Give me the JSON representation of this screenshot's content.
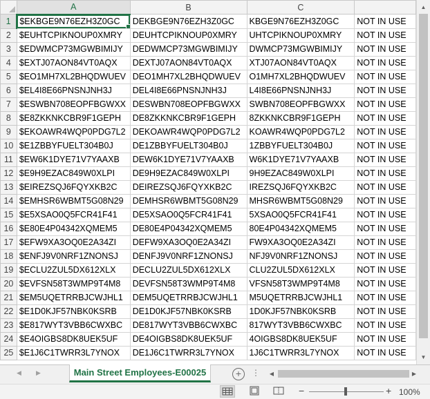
{
  "columns": [
    "A",
    "B",
    "C",
    ""
  ],
  "rows": [
    {
      "num": "1",
      "a": "$EKBGE9N76EZH3Z0GC",
      "b": "DEKBGE9N76EZH3Z0GC",
      "c": "KBGE9N76EZH3Z0GC",
      "d": "NOT IN USE"
    },
    {
      "num": "2",
      "a": "$EUHTCPIKNOUP0XMRY",
      "b": "DEUHTCPIKNOUP0XMRY",
      "c": "UHTCPIKNOUP0XMRY",
      "d": "NOT IN USE"
    },
    {
      "num": "3",
      "a": "$EDWMCP73MGWBIMIJY",
      "b": "DEDWMCP73MGWBIMIJY",
      "c": "DWMCP73MGWBIMIJY",
      "d": "NOT IN USE"
    },
    {
      "num": "4",
      "a": "$EXTJ07AON84VT0AQX",
      "b": "DEXTJ07AON84VT0AQX",
      "c": "XTJ07AON84VT0AQX",
      "d": "NOT IN USE"
    },
    {
      "num": "5",
      "a": "$EO1MH7XL2BHQDWUEV",
      "b": "DEO1MH7XL2BHQDWUEV",
      "c": "O1MH7XL2BHQDWUEV",
      "d": "NOT IN USE"
    },
    {
      "num": "6",
      "a": "$EL4I8E66PNSNJNH3J",
      "b": "DEL4I8E66PNSNJNH3J",
      "c": "L4I8E66PNSNJNH3J",
      "d": "NOT IN USE"
    },
    {
      "num": "7",
      "a": "$ESWBN708EOPFBGWXX",
      "b": "DESWBN708EOPFBGWXX",
      "c": "SWBN708EOPFBGWXX",
      "d": "NOT IN USE"
    },
    {
      "num": "8",
      "a": "$E8ZKKNKCBR9F1GEPH",
      "b": "DE8ZKKNKCBR9F1GEPH",
      "c": "8ZKKNKCBR9F1GEPH",
      "d": "NOT IN USE"
    },
    {
      "num": "9",
      "a": "$EKOAWR4WQP0PDG7L2",
      "b": "DEKOAWR4WQP0PDG7L2",
      "c": "KOAWR4WQP0PDG7L2",
      "d": "NOT IN USE"
    },
    {
      "num": "10",
      "a": "$E1ZBBYFUELT304B0J",
      "b": "DE1ZBBYFUELT304B0J",
      "c": "1ZBBYFUELT304B0J",
      "d": "NOT IN USE"
    },
    {
      "num": "11",
      "a": "$EW6K1DYE71V7YAAXB",
      "b": "DEW6K1DYE71V7YAAXB",
      "c": "W6K1DYE71V7YAAXB",
      "d": "NOT IN USE"
    },
    {
      "num": "12",
      "a": "$E9H9EZAC849W0XLPI",
      "b": "DE9H9EZAC849W0XLPI",
      "c": "9H9EZAC849W0XLPI",
      "d": "NOT IN USE"
    },
    {
      "num": "13",
      "a": "$EIREZSQJ6FQYXKB2C",
      "b": "DEIREZSQJ6FQYXKB2C",
      "c": "IREZSQJ6FQYXKB2C",
      "d": "NOT IN USE"
    },
    {
      "num": "14",
      "a": "$EMHSR6WBMT5G08N29",
      "b": "DEMHSR6WBMT5G08N29",
      "c": "MHSR6WBMT5G08N29",
      "d": "NOT IN USE"
    },
    {
      "num": "15",
      "a": "$E5XSAO0Q5FCR41F41",
      "b": "DE5XSAO0Q5FCR41F41",
      "c": "5XSAO0Q5FCR41F41",
      "d": "NOT IN USE"
    },
    {
      "num": "16",
      "a": "$E80E4P04342XQMEM5",
      "b": "DE80E4P04342XQMEM5",
      "c": "80E4P04342XQMEM5",
      "d": "NOT IN USE"
    },
    {
      "num": "17",
      "a": "$EFW9XA3OQ0E2A34ZI",
      "b": "DEFW9XA3OQ0E2A34ZI",
      "c": "FW9XA3OQ0E2A34ZI",
      "d": "NOT IN USE"
    },
    {
      "num": "18",
      "a": "$ENFJ9V0NRF1ZNONSJ",
      "b": "DENFJ9V0NRF1ZNONSJ",
      "c": "NFJ9V0NRF1ZNONSJ",
      "d": "NOT IN USE"
    },
    {
      "num": "19",
      "a": "$ECLU2ZUL5DX612XLX",
      "b": "DECLU2ZUL5DX612XLX",
      "c": "CLU2ZUL5DX612XLX",
      "d": "NOT IN USE"
    },
    {
      "num": "20",
      "a": "$EVFSN58T3WMP9T4M8",
      "b": "DEVFSN58T3WMP9T4M8",
      "c": "VFSN58T3WMP9T4M8",
      "d": "NOT IN USE"
    },
    {
      "num": "21",
      "a": "$EM5UQETRRBJCWJHL1",
      "b": "DEM5UQETRRBJCWJHL1",
      "c": "M5UQETRRBJCWJHL1",
      "d": "NOT IN USE"
    },
    {
      "num": "22",
      "a": "$E1D0KJF57NBK0KSRB",
      "b": "DE1D0KJF57NBK0KSRB",
      "c": "1D0KJF57NBK0KSRB",
      "d": "NOT IN USE"
    },
    {
      "num": "23",
      "a": "$E817WYT3VBB6CWXBC",
      "b": "DE817WYT3VBB6CWXBC",
      "c": "817WYT3VBB6CWXBC",
      "d": "NOT IN USE"
    },
    {
      "num": "24",
      "a": "$E4OIGBS8DK8UEK5UF",
      "b": "DE4OIGBS8DK8UEK5UF",
      "c": "4OIGBS8DK8UEK5UF",
      "d": "NOT IN USE"
    },
    {
      "num": "25",
      "a": "$E1J6C1TWRR3L7YNOX",
      "b": "DE1J6C1TWRR3L7YNOX",
      "c": "1J6C1TWRR3L7YNOX",
      "d": "NOT IN USE"
    }
  ],
  "sheet_tab": {
    "label": "Main Street Employees-E00025"
  },
  "status": {
    "zoom": "100%"
  },
  "icons": {
    "sheet_nav_prev": "chevron-left-icon",
    "sheet_nav_next": "chevron-right-icon",
    "add_sheet": "plus-circle-icon",
    "normal_view": "grid-view-icon",
    "page_layout_view": "page-layout-icon",
    "page_break_view": "page-break-icon"
  },
  "colors": {
    "accent": "#217346",
    "header_bg": "#f3f3f3",
    "gridline": "#d4d4d4"
  }
}
